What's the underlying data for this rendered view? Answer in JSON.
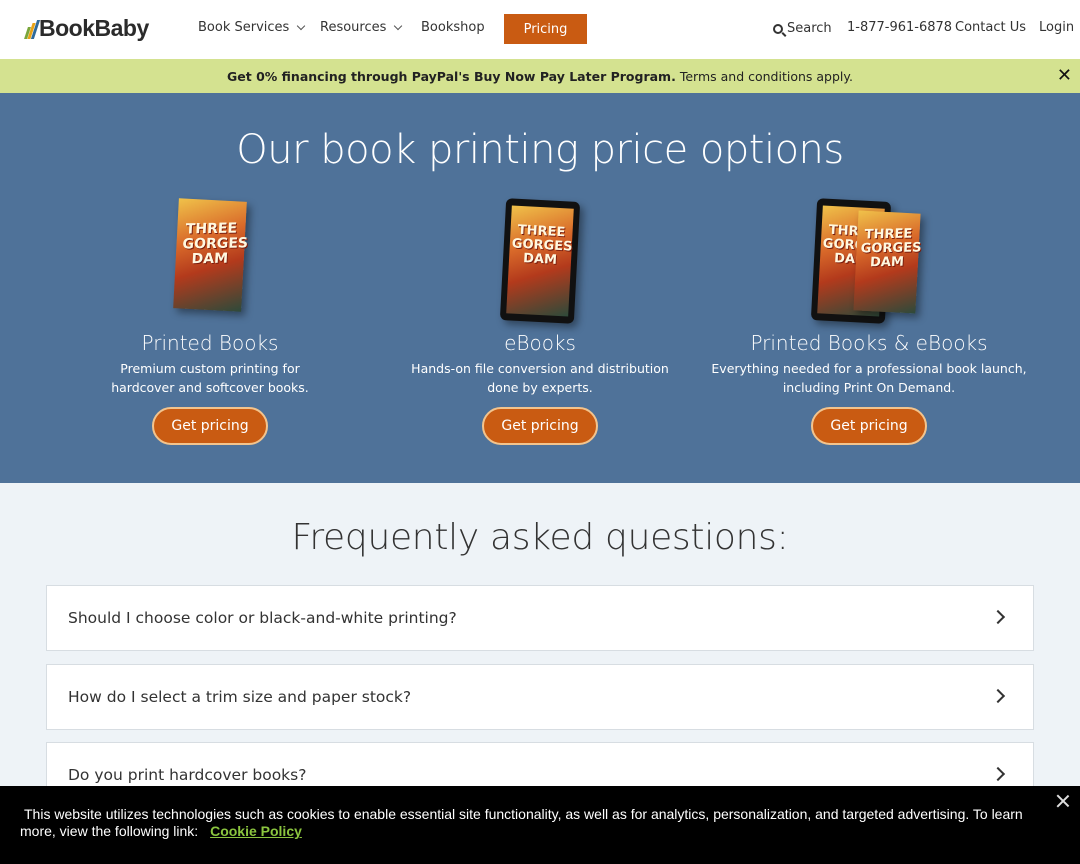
{
  "header": {
    "logo": "BookBaby",
    "nav": [
      {
        "label": "Book Services",
        "dropdown": true
      },
      {
        "label": "Resources",
        "dropdown": true
      },
      {
        "label": "Bookshop",
        "dropdown": false
      }
    ],
    "pricing_label": "Pricing",
    "search_label": "Search",
    "phone": "1-877-961-6878",
    "contact_label": "Contact Us",
    "login_label": "Login"
  },
  "promo": {
    "bold_text": "Get 0% financing through PayPal's Buy Now Pay Later Program.",
    "text": "Terms and conditions apply.",
    "close_icon": "close-icon"
  },
  "hero": {
    "title": "Our book printing price options",
    "cover_text": "THREE GORGES DAM",
    "columns": [
      {
        "title": "Printed Books",
        "desc_line1": "Premium custom printing for",
        "desc_line2": "hardcover and softcover books.",
        "button": "Get pricing"
      },
      {
        "title": "eBooks",
        "desc_line1": "Hands-on file conversion and distribution",
        "desc_line2": "done by experts.",
        "button": "Get pricing"
      },
      {
        "title": "Printed Books & eBooks",
        "desc_line1": "Everything needed for a professional book launch,",
        "desc_line2": "including Print On Demand.",
        "button": "Get pricing"
      }
    ]
  },
  "faq": {
    "title": "Frequently asked questions:",
    "items": [
      "Should I choose color or black-and-white printing?",
      "How do I select a trim size and paper stock?",
      "Do you print hardcover books?"
    ]
  },
  "cookie": {
    "text": "This website utilizes technologies such as cookies to enable essential site functionality, as well as for analytics, personalization, and targeted advertising. To learn more, view the following link:",
    "link": "Cookie Policy"
  },
  "colors": {
    "brand_orange": "#c95b12",
    "hero_blue": "#4f7299",
    "promo_green": "#d4e290",
    "cookie_link": "#8bc53f"
  }
}
